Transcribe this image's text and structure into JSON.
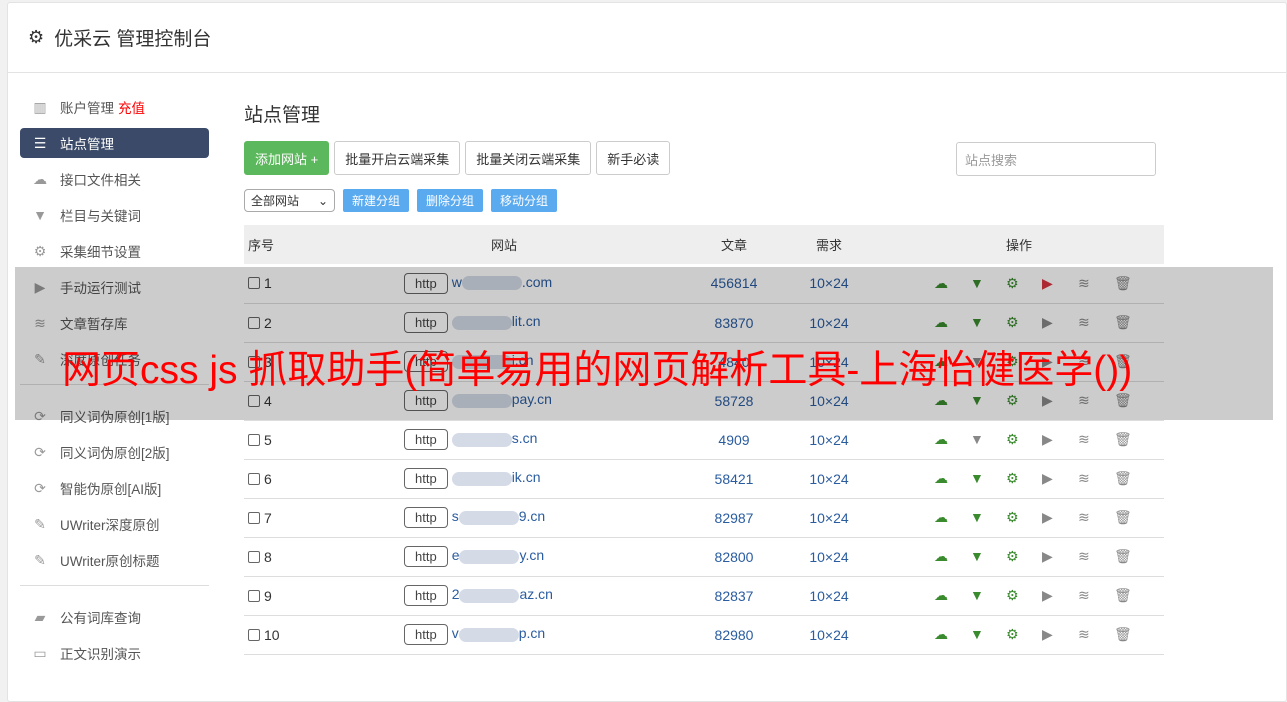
{
  "header": {
    "title": "优采云 管理控制台",
    "icon": "gear-icon"
  },
  "sidebar": {
    "items": [
      {
        "label": "账户管理",
        "extra": "充值",
        "icon": "bar-chart-icon"
      },
      {
        "label": "站点管理",
        "icon": "server-icon",
        "active": true
      },
      {
        "label": "接口文件相关",
        "icon": "cloud-upload-icon"
      },
      {
        "label": "栏目与关键词",
        "icon": "filter-icon"
      },
      {
        "label": "采集细节设置",
        "icon": "gears-icon"
      },
      {
        "label": "手动运行测试",
        "icon": "play-icon"
      },
      {
        "label": "文章暂存库",
        "icon": "database-icon"
      },
      {
        "label": "深度原创任务",
        "icon": "edit-icon"
      },
      {
        "label": "同义词伪原创[1版]",
        "icon": "refresh-icon"
      },
      {
        "label": "同义词伪原创[2版]",
        "icon": "refresh-icon"
      },
      {
        "label": "智能伪原创[AI版]",
        "icon": "refresh-icon"
      },
      {
        "label": "UWriter深度原创",
        "icon": "edit-icon"
      },
      {
        "label": "UWriter原创标题",
        "icon": "edit-icon"
      },
      {
        "label": "公有词库查询",
        "icon": "book-icon"
      },
      {
        "label": "正文识别演示",
        "icon": "monitor-icon"
      }
    ]
  },
  "main": {
    "title": "站点管理",
    "buttons": {
      "add": "添加网站 +",
      "batch_on": "批量开启云端采集",
      "batch_off": "批量关闭云端采集",
      "guide": "新手必读"
    },
    "search_placeholder": "站点搜索",
    "group_select": "全部网站",
    "group_buttons": {
      "new": "新建分组",
      "delete": "删除分组",
      "move": "移动分组"
    },
    "columns": [
      "序号",
      "网站",
      "文章",
      "需求",
      "操作"
    ],
    "rows": [
      {
        "id": "1",
        "proto": "http",
        "pre": "w",
        "suf": ".com",
        "articles": "456814",
        "demand": "10×24",
        "filter_active": true,
        "play_red": true
      },
      {
        "id": "2",
        "proto": "http",
        "pre": "",
        "suf": "lit.cn",
        "articles": "83870",
        "demand": "10×24",
        "filter_active": true
      },
      {
        "id": "3",
        "proto": "http",
        "pre": "",
        "suf": "i.cn",
        "articles": "4840",
        "demand": "10×24",
        "filter_active": false
      },
      {
        "id": "4",
        "proto": "http",
        "pre": "",
        "suf": "pay.cn",
        "articles": "58728",
        "demand": "10×24",
        "filter_active": true
      },
      {
        "id": "5",
        "proto": "http",
        "pre": "",
        "suf": "s.cn",
        "articles": "4909",
        "demand": "10×24",
        "filter_active": false
      },
      {
        "id": "6",
        "proto": "http",
        "pre": "",
        "suf": "ik.cn",
        "articles": "58421",
        "demand": "10×24",
        "filter_active": true
      },
      {
        "id": "7",
        "proto": "http",
        "pre": "s",
        "suf": "9.cn",
        "articles": "82987",
        "demand": "10×24",
        "filter_active": true
      },
      {
        "id": "8",
        "proto": "http",
        "pre": "e",
        "suf": "y.cn",
        "articles": "82800",
        "demand": "10×24",
        "filter_active": true
      },
      {
        "id": "9",
        "proto": "http",
        "pre": "2",
        "suf": "az.cn",
        "articles": "82837",
        "demand": "10×24",
        "filter_active": true
      },
      {
        "id": "10",
        "proto": "http",
        "pre": "v",
        "suf": "p.cn",
        "articles": "82980",
        "demand": "10×24",
        "filter_active": true
      }
    ]
  },
  "watermark": "网页css js 抓取助手(简单易用的网页解析工具-上海怡健医学())",
  "colors": {
    "active_nav": "#3a4a68",
    "green_button": "#5cb85c",
    "blue_button": "#5aaaf0",
    "watermark": "#ff0000"
  }
}
